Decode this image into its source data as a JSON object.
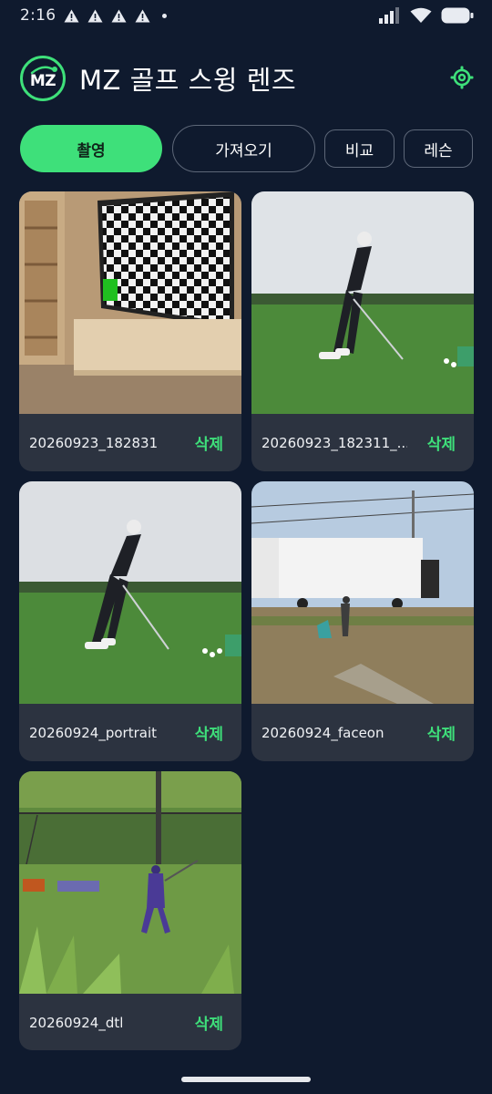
{
  "status_bar": {
    "time": "2:16",
    "icons": [
      "warning-icon",
      "warning-icon",
      "warning-icon",
      "warning-icon",
      "notification-dot-icon",
      "signal-icon",
      "wifi-icon",
      "battery-icon"
    ]
  },
  "header": {
    "logo_text": "MZ",
    "title": "MZ 골프 스윙 렌즈",
    "settings_icon": "gear-icon"
  },
  "tabs": [
    {
      "label": "촬영",
      "active": true
    },
    {
      "label": "가져오기",
      "active": false
    },
    {
      "label": "비교",
      "active": false
    },
    {
      "label": "레슨",
      "active": false
    }
  ],
  "videos": [
    {
      "name": "20260923_182831",
      "delete_label": "삭제"
    },
    {
      "name": "20260923_182311_...",
      "delete_label": "삭제"
    },
    {
      "name": "20260924_portrait",
      "delete_label": "삭제"
    },
    {
      "name": "20260924_faceon",
      "delete_label": "삭제"
    },
    {
      "name": "20260924_dtl",
      "delete_label": "삭제"
    }
  ],
  "colors": {
    "background": "#0f1a2e",
    "accent": "#3ee07a",
    "card": "#2c3340"
  }
}
